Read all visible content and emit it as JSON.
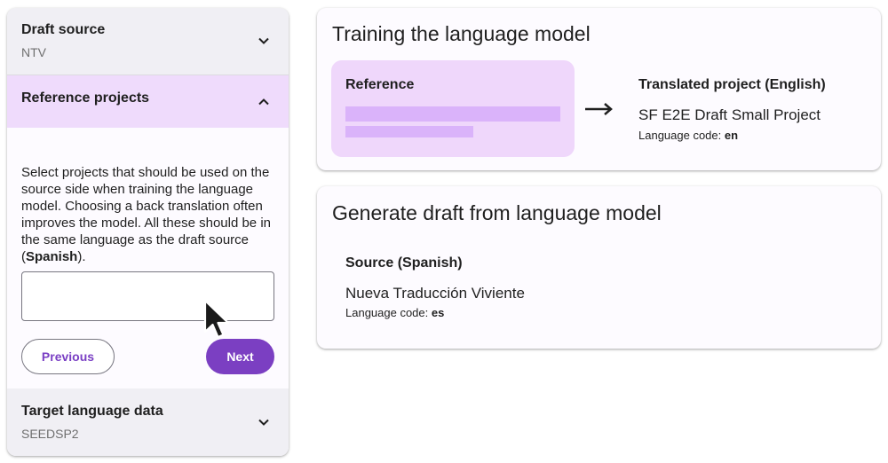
{
  "stepper": {
    "draft_source": {
      "title": "Draft source",
      "value": "NTV",
      "icon": "chevron-down-icon"
    },
    "reference_projects": {
      "title": "Reference projects",
      "icon": "chevron-up-icon",
      "description_before": "Select projects that should be used on the source side when training the language model. Choosing a back translation often improves the model. All these should be in the same language as the draft source (",
      "description_language": "Spanish",
      "description_after": ").",
      "input_value": "",
      "previous_label": "Previous",
      "next_label": "Next"
    },
    "target_language_data": {
      "title": "Target language data",
      "value": "SEEDSP2",
      "icon": "chevron-down-icon"
    }
  },
  "training_card": {
    "title": "Training the language model",
    "reference_label": "Reference",
    "arrow_icon": "arrow-right-icon",
    "translated_label": "Translated project (English)",
    "translated_project_name": "SF E2E Draft Small Project",
    "language_code_label": "Language code: ",
    "language_code": "en"
  },
  "generate_card": {
    "title": "Generate draft from language model",
    "source_label": "Source (Spanish)",
    "source_project_name": "Nueva Traducción Viviente",
    "language_code_label": "Language code: ",
    "language_code": "es"
  },
  "colors": {
    "accent": "#7b3fc2",
    "selected_header": "#efdbfc",
    "reference_box": "#efd7fb",
    "skeleton": "#dab3fa"
  },
  "cursor": "mouse-pointer-icon"
}
